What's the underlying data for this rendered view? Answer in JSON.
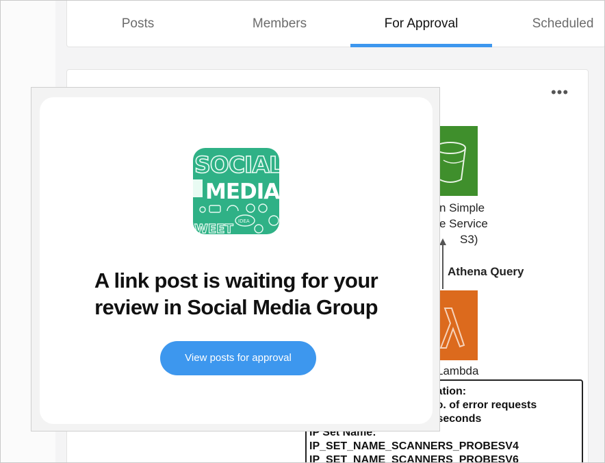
{
  "tabs": [
    {
      "label": "Posts",
      "active": false
    },
    {
      "label": "Members",
      "active": false
    },
    {
      "label": "For Approval",
      "active": true
    },
    {
      "label": "Scheduled",
      "active": false
    }
  ],
  "feed": {
    "more_icon": "more-horizontal-icon",
    "diagram": {
      "s3_lines": [
        "n Simple",
        "e Service",
        "S3)"
      ],
      "query_label": "Athena Query",
      "lambda_label": "Lambda",
      "config_lines": [
        "figuration:",
        "XX no. of error requests",
        "XXX seconds",
        "IP Set Name:",
        "IP_SET_NAME_SCANNERS_PROBESV4",
        "IP_SET_NAME_SCANNERS_PROBESV6"
      ]
    }
  },
  "modal": {
    "logo_top_text": "SOCIAL",
    "logo_main_text": "MEDIA",
    "logo_small_text": "IDEA",
    "logo_bottom_text": "WEET",
    "message": "A link post is waiting for your review in Social Media Group",
    "cta_label": "View posts for approval"
  },
  "colors": {
    "accent": "#3d97ee",
    "logo_bg": "#2fb186",
    "s3_green": "#3f8f2c",
    "lambda_orange": "#dc6a1d"
  }
}
